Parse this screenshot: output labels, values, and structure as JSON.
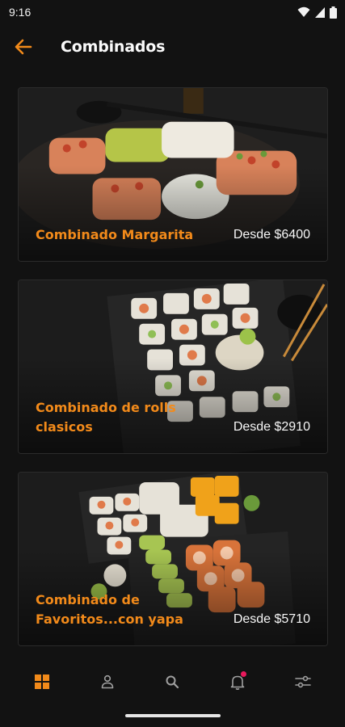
{
  "status_bar": {
    "time": "9:16"
  },
  "header": {
    "title": "Combinados"
  },
  "products": [
    {
      "name": "Combinado Margarita",
      "price": "Desde $6400"
    },
    {
      "name": "Combinado de rolls clasicos",
      "price": "Desde $2910"
    },
    {
      "name": "Combinado de Favoritos...con yapa",
      "price": "Desde $5710"
    }
  ],
  "nav": {
    "items": [
      "grid-icon",
      "user-icon",
      "search-icon",
      "bell-icon",
      "sliders-icon"
    ],
    "active": "grid-icon"
  },
  "colors": {
    "accent": "#f28a1a",
    "background": "#121212",
    "notification": "#e8195c"
  }
}
